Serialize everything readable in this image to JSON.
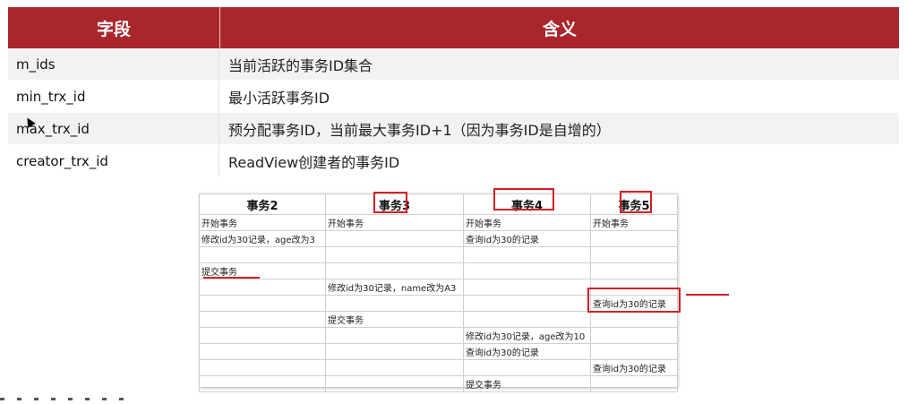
{
  "field_table": {
    "header": {
      "field": "字段",
      "meaning": "含义"
    },
    "rows": [
      {
        "field": "m_ids",
        "meaning": "当前活跃的事务ID集合"
      },
      {
        "field": "min_trx_id",
        "meaning": "最小活跃事务ID"
      },
      {
        "field": "max_trx_id",
        "meaning": "预分配事务ID，当前最大事务ID+1（因为事务ID是自增的）"
      },
      {
        "field": "creator_trx_id",
        "meaning": "ReadView创建者的事务ID"
      }
    ]
  },
  "txn_sheet": {
    "headers": [
      "事务2",
      "事务3",
      "事务4",
      "事务5"
    ],
    "rows": [
      [
        "开始事务",
        "开始事务",
        "开始事务",
        "开始事务"
      ],
      [
        "修改id为30记录，age改为3",
        "",
        "查询id为30的记录",
        ""
      ],
      [
        "",
        "",
        "",
        ""
      ],
      [
        "提交事务",
        "",
        "",
        ""
      ],
      [
        "",
        "修改id为30记录，name改为A3",
        "",
        ""
      ],
      [
        "",
        "",
        "",
        "查询id为30的记录"
      ],
      [
        "",
        "提交事务",
        "",
        ""
      ],
      [
        "",
        "",
        "修改id为30记录，age改为10",
        ""
      ],
      [
        "",
        "",
        "查询id为30的记录",
        ""
      ],
      [
        "",
        "",
        "",
        "查询id为30的记录"
      ],
      [
        "",
        "",
        "提交事务",
        ""
      ]
    ]
  },
  "colors": {
    "header_bg": "#a9262a",
    "annotation_red": "#d21f26",
    "row_alt": "#f2f2f2"
  }
}
